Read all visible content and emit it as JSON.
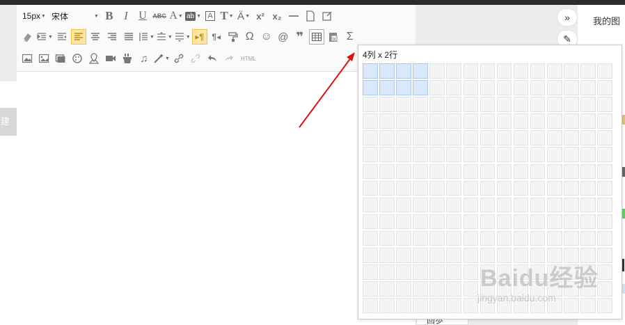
{
  "toolbar": {
    "font_size": "15px",
    "font_family": "宋体",
    "html_label": "HTML",
    "omega": "Ω",
    "sigma": "Σ",
    "superscript": "x²",
    "subscript": "x₂",
    "quote": "❞"
  },
  "table_picker": {
    "label": "4列 x 2行",
    "columns": 15,
    "rows": 15,
    "selected_columns": 4,
    "selected_rows": 2
  },
  "right_panel": {
    "title": "我的图",
    "expand_glyph": "»",
    "wand_glyph": "✎"
  },
  "left_tab": {
    "label": "建"
  },
  "watermark": {
    "main": "Baidu经验",
    "sub": "jingyan.baidu.com"
  },
  "bottom_item": {
    "label": "回歩"
  },
  "colors": {
    "accent_fill": "#ffe7a3",
    "selected_cell": "#d9e8fb",
    "arrow": "#e01010"
  }
}
